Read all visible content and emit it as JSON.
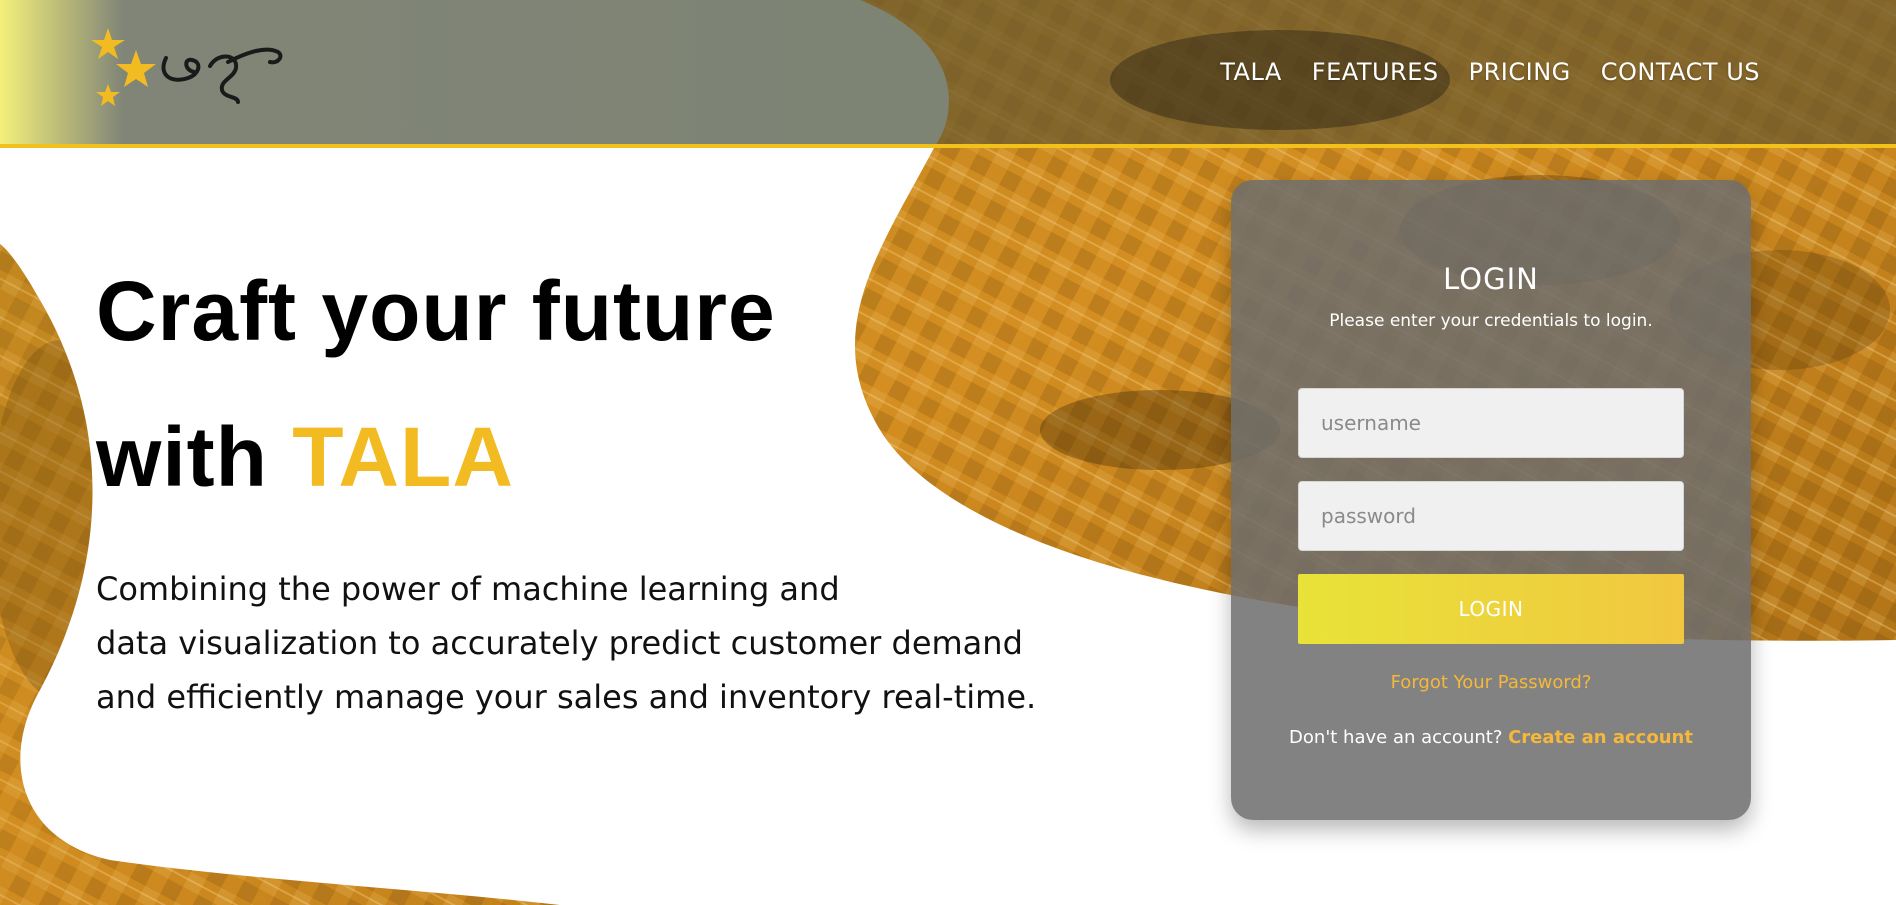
{
  "brand": {
    "logo_name": "TALA stars logo"
  },
  "nav": {
    "items": [
      {
        "label": "TALA"
      },
      {
        "label": "FEATURES"
      },
      {
        "label": "PRICING"
      },
      {
        "label": "CONTACT US"
      }
    ]
  },
  "hero": {
    "title_line1": "Craft your future",
    "title_line2_prefix": "with ",
    "title_line2_accent": "TALA",
    "subtitle_lines": [
      "Combining the power of machine learning and",
      "data visualization to accurately predict customer demand",
      "and efficiently manage your sales and inventory real-time."
    ]
  },
  "login": {
    "title": "LOGIN",
    "subtitle": "Please enter your credentials to login.",
    "username_placeholder": "username",
    "username_value": "",
    "password_placeholder": "password",
    "password_value": "",
    "button_label": "LOGIN",
    "forgot_label": "Forgot Your Password?",
    "signup_prompt": "Don't have an account?",
    "signup_link": "Create an account"
  },
  "colors": {
    "accent": "#f2bb22",
    "header_line": "#f2c21a",
    "link": "#f5b83a",
    "card_bg": "#6e6e6e"
  }
}
